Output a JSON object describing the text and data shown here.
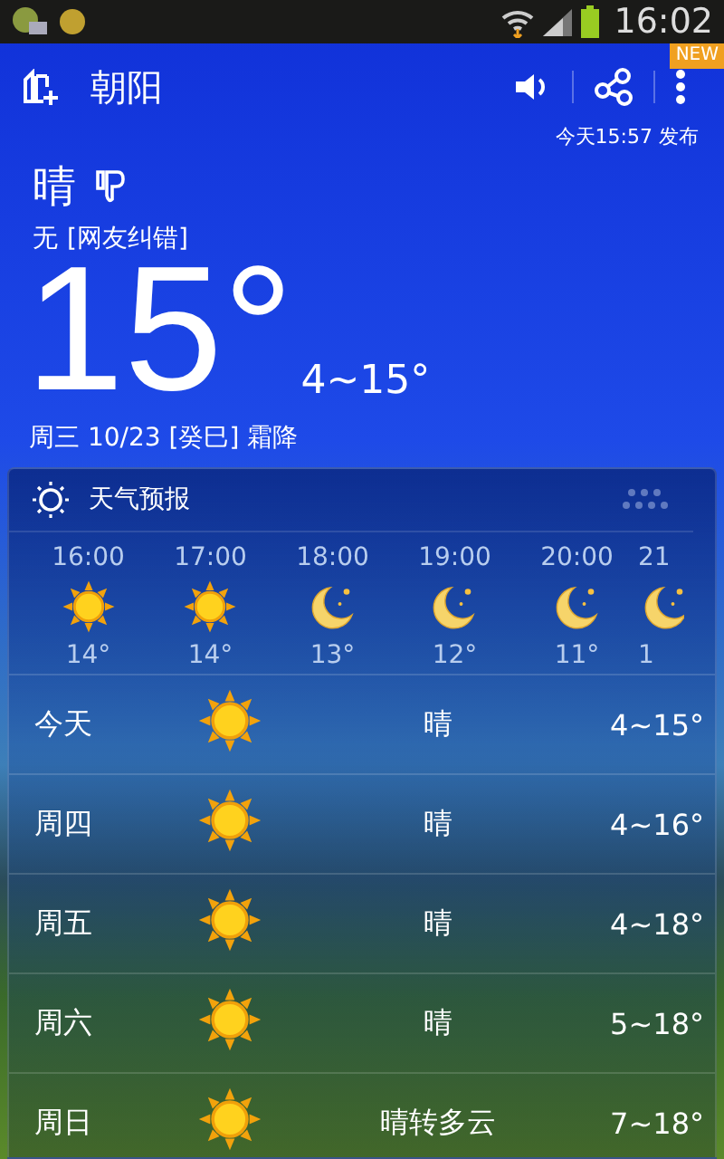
{
  "status_bar": {
    "time": "16:02"
  },
  "header": {
    "city": "朝阳",
    "badge": "NEW"
  },
  "current": {
    "published": "今天15:57 发布",
    "condition": "晴",
    "air_quality": "无",
    "correction_link": "[网友纠错]",
    "temperature": "15°",
    "range": "4~15°",
    "date": "周三 10/23 [癸巳] 霜降"
  },
  "forecast": {
    "title": "天气预报",
    "hourly": [
      {
        "time": "16:00",
        "kind": "sun",
        "temp": "14°"
      },
      {
        "time": "17:00",
        "kind": "sun",
        "temp": "14°"
      },
      {
        "time": "18:00",
        "kind": "moon",
        "temp": "13°"
      },
      {
        "time": "19:00",
        "kind": "moon",
        "temp": "12°"
      },
      {
        "time": "20:00",
        "kind": "moon",
        "temp": "11°"
      },
      {
        "time": "21",
        "kind": "moon",
        "temp": "1"
      }
    ],
    "daily": [
      {
        "day": "今天",
        "kind": "sun",
        "condition": "晴",
        "range": "4~15°"
      },
      {
        "day": "周四",
        "kind": "sun",
        "condition": "晴",
        "range": "4~16°"
      },
      {
        "day": "周五",
        "kind": "sun",
        "condition": "晴",
        "range": "4~18°"
      },
      {
        "day": "周六",
        "kind": "sun",
        "condition": "晴",
        "range": "5~18°"
      },
      {
        "day": "周日",
        "kind": "sun",
        "condition": "晴转多云",
        "range": "7~18°"
      }
    ]
  }
}
